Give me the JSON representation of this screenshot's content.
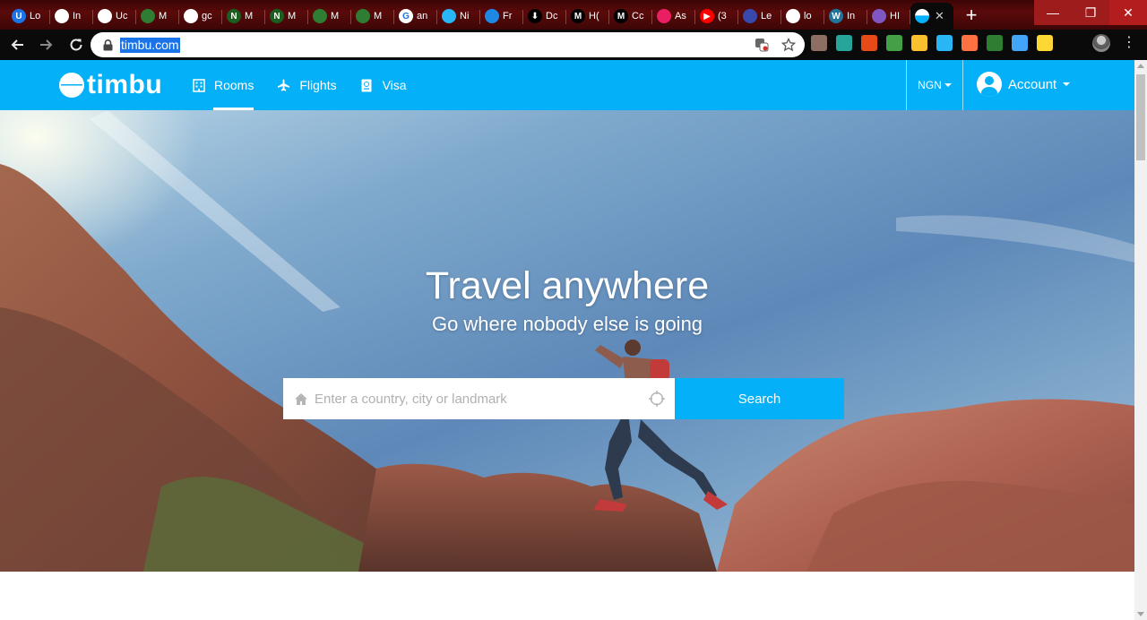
{
  "browser": {
    "tabs": [
      {
        "label": "Lo",
        "fav_bg": "#1a73e8",
        "fav_text": "U"
      },
      {
        "label": "In",
        "fav_bg": "#ffffff",
        "fav_text": ""
      },
      {
        "label": "Uc",
        "fav_bg": "#ffffff",
        "fav_text": ""
      },
      {
        "label": "M",
        "fav_bg": "#2e7d32",
        "fav_text": ""
      },
      {
        "label": "gc",
        "fav_bg": "#ffffff",
        "fav_text": ""
      },
      {
        "label": "M",
        "fav_bg": "#1b5e20",
        "fav_text": "N"
      },
      {
        "label": "M",
        "fav_bg": "#1b5e20",
        "fav_text": "N"
      },
      {
        "label": "M",
        "fav_bg": "#2e7d32",
        "fav_text": ""
      },
      {
        "label": "M",
        "fav_bg": "#2e7d32",
        "fav_text": ""
      },
      {
        "label": "an",
        "fav_bg": "#ffffff",
        "fav_text": "G"
      },
      {
        "label": "Ni",
        "fav_bg": "#29b6f6",
        "fav_text": ""
      },
      {
        "label": "Fr",
        "fav_bg": "#1e88e5",
        "fav_text": ""
      },
      {
        "label": "Dc",
        "fav_bg": "#000000",
        "fav_text": "⬇"
      },
      {
        "label": "H(",
        "fav_bg": "#000000",
        "fav_text": "M"
      },
      {
        "label": "Cc",
        "fav_bg": "#000000",
        "fav_text": "M"
      },
      {
        "label": "As",
        "fav_bg": "#e91e63",
        "fav_text": ""
      },
      {
        "label": "(3",
        "fav_bg": "#ff0000",
        "fav_text": "▶"
      },
      {
        "label": "Le",
        "fav_bg": "#3949ab",
        "fav_text": ""
      },
      {
        "label": "lo",
        "fav_bg": "#ffffff",
        "fav_text": ""
      },
      {
        "label": "In",
        "fav_bg": "#21759b",
        "fav_text": "W"
      },
      {
        "label": "HI",
        "fav_bg": "#7e57c2",
        "fav_text": ""
      }
    ],
    "active_tab": {
      "fav_bg": "#04b0f7"
    },
    "new_tab_label": "+",
    "window": {
      "minimize": "—",
      "restore": "❐",
      "close": "✕"
    },
    "url": "timbu.com",
    "extension_colors": [
      "#8d6e63",
      "#26a69a",
      "#e64a19",
      "#43a047",
      "#fbc02d",
      "#29b6f6",
      "#ff7043",
      "#2e7d32",
      "#42a5f5",
      "#fdd835"
    ]
  },
  "site": {
    "brand": "timbu",
    "nav": [
      {
        "label": "Rooms",
        "icon": "building-icon",
        "active": true
      },
      {
        "label": "Flights",
        "icon": "plane-icon",
        "active": false
      },
      {
        "label": "Visa",
        "icon": "passport-icon",
        "active": false
      }
    ],
    "currency": "NGN",
    "account_label": "Account",
    "accent": "#04b0f7"
  },
  "hero": {
    "title": "Travel anywhere",
    "subtitle": "Go where nobody else is going",
    "search_placeholder": "Enter a country, city or landmark",
    "search_button": "Search"
  }
}
